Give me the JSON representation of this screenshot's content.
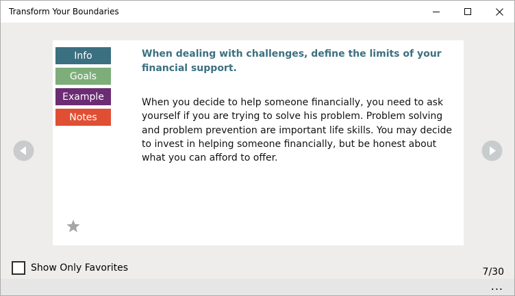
{
  "window": {
    "title": "Transform Your Boundaries"
  },
  "tabs": [
    {
      "label": "Info",
      "color": "#3b7080"
    },
    {
      "label": "Goals",
      "color": "#7dae79"
    },
    {
      "label": "Example",
      "color": "#6b2c73"
    },
    {
      "label": "Notes",
      "color": "#e04f34"
    }
  ],
  "card": {
    "heading": "When dealing with challenges, define the limits of your financial support.",
    "heading_color": "#3b7080",
    "body": "When you decide to help someone financially, you need to ask yourself if you are trying to solve his problem. Problem solving and problem prevention are important life skills. You may decide to invest in helping someone financially, but be honest about what you can afford to offer.",
    "favorite_icon": "star-icon"
  },
  "navigation": {
    "prev_icon": "chevron-left-icon",
    "next_icon": "chevron-right-icon"
  },
  "footer": {
    "favorites_label": "Show Only Favorites",
    "favorites_checked": false,
    "page_indicator": "7/30",
    "more_label": "..."
  }
}
